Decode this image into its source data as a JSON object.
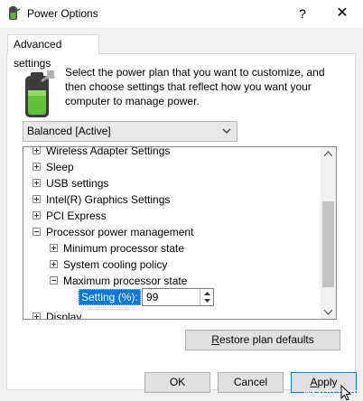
{
  "window": {
    "title": "Power Options",
    "help_glyph": "?",
    "close_glyph": "✕",
    "app_icon": "power-options-icon"
  },
  "tab": {
    "label": "Advanced settings"
  },
  "intro": {
    "icon": "battery-plug-icon",
    "text": "Select the power plan that you want to customize, and then choose settings that reflect how you want your computer to manage power."
  },
  "plan": {
    "selected": "Balanced [Active]"
  },
  "tree": {
    "items": [
      {
        "label": "Wireless Adapter Settings",
        "expanded": false
      },
      {
        "label": "Sleep",
        "expanded": false
      },
      {
        "label": "USB settings",
        "expanded": false
      },
      {
        "label": "Intel(R) Graphics Settings",
        "expanded": false
      },
      {
        "label": "PCI Express",
        "expanded": false
      },
      {
        "label": "Processor power management",
        "expanded": true
      },
      {
        "label": "Minimum processor state",
        "expanded": false
      },
      {
        "label": "System cooling policy",
        "expanded": false
      },
      {
        "label": "Maximum processor state",
        "expanded": true
      }
    ],
    "setting_label": "Setting (%):",
    "setting_value": "99",
    "partial_item": "Display"
  },
  "buttons": {
    "restore_first": "R",
    "restore_rest": "estore plan defaults",
    "ok": "OK",
    "cancel": "Cancel",
    "apply_first": "A",
    "apply_rest": "pply"
  },
  "watermark": "wsxdn.com",
  "colors": {
    "selection": "#0078d7",
    "dialog_bg": "#f0f0f0"
  }
}
